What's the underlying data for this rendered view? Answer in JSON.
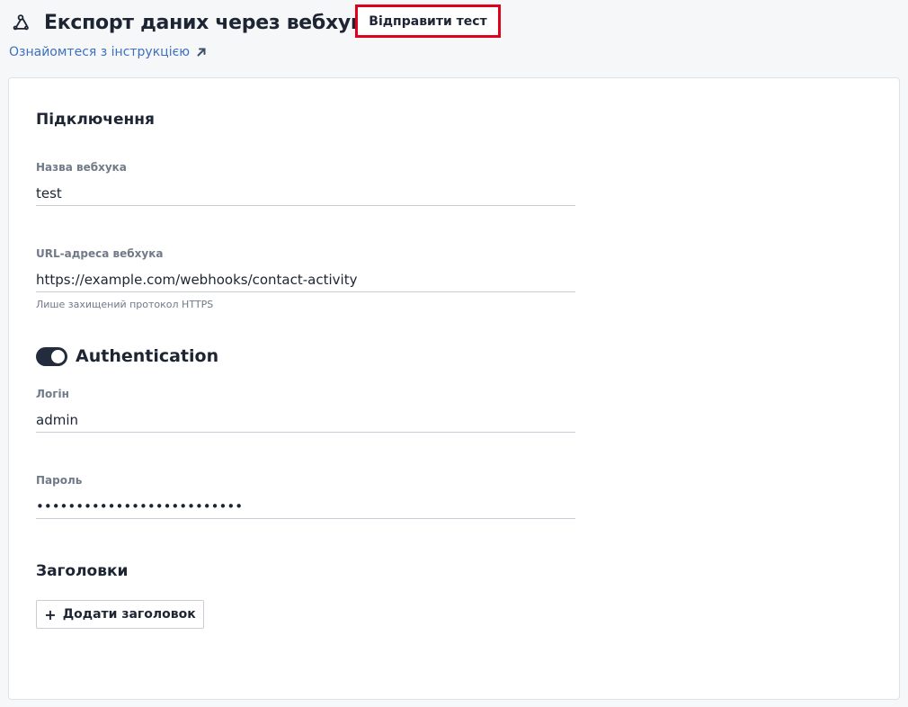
{
  "header": {
    "icon": "webhook-icon",
    "title": "Експорт даних через вебхук",
    "send_test_label": "Відправити тест",
    "accent_color": "#e0001b"
  },
  "guide_link": {
    "label": "Ознайомтеся з інструкцією",
    "icon": "external-link-arrow-icon"
  },
  "connection": {
    "title": "Підключення",
    "name": {
      "label": "Назва вебхука",
      "value": "test"
    },
    "url": {
      "label": "URL-адреса вебхука",
      "value": "https://example.com/webhooks/contact-activity",
      "hint": "Лише захищений протокол HTTPS"
    }
  },
  "authentication": {
    "title": "Authentication",
    "enabled": true,
    "login": {
      "label": "Логін",
      "value": "admin"
    },
    "password": {
      "label": "Пароль",
      "value": "••••••••••••••••••••••••••"
    }
  },
  "headers": {
    "title": "Заголовки",
    "add_label": "Додати заголовок",
    "add_icon": "plus-icon"
  }
}
